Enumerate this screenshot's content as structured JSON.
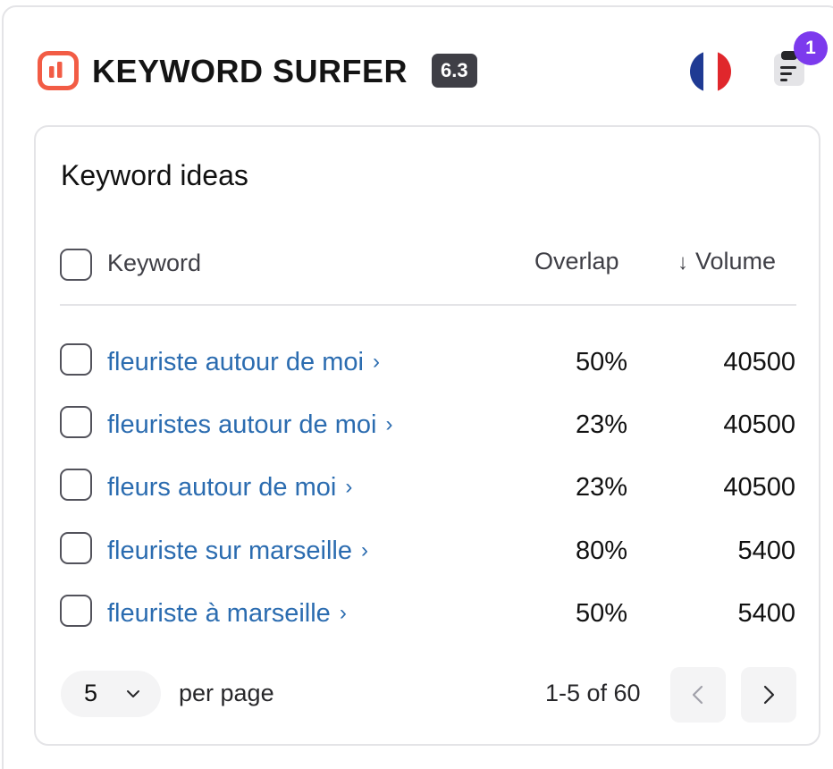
{
  "header": {
    "brand": "KEYWORD SURFER",
    "version": "6.3",
    "flag": "france-flag",
    "notes_icon": "list-icon",
    "notes_badge": "1",
    "colors": {
      "logo": "#f25c45",
      "badge": "#7c3aed",
      "version_bg": "#3f3f46"
    }
  },
  "card": {
    "title": "Keyword ideas",
    "columns": {
      "keyword": "Keyword",
      "overlap": "Overlap",
      "volume": "Volume",
      "sort_icon": "arrow-down-icon"
    },
    "rows": [
      {
        "keyword": "fleuriste autour de moi",
        "overlap": "50%",
        "volume": "40500"
      },
      {
        "keyword": "fleuristes autour de moi",
        "overlap": "23%",
        "volume": "40500"
      },
      {
        "keyword": "fleurs autour de moi",
        "overlap": "23%",
        "volume": "40500"
      },
      {
        "keyword": "fleuriste sur marseille",
        "overlap": "80%",
        "volume": "5400"
      },
      {
        "keyword": "fleuriste à marseille",
        "overlap": "50%",
        "volume": "5400"
      }
    ],
    "footer": {
      "per_page_value": "5",
      "per_page_label": "per page",
      "range": "1-5 of 60"
    },
    "link_color": "#2b6cb0"
  }
}
